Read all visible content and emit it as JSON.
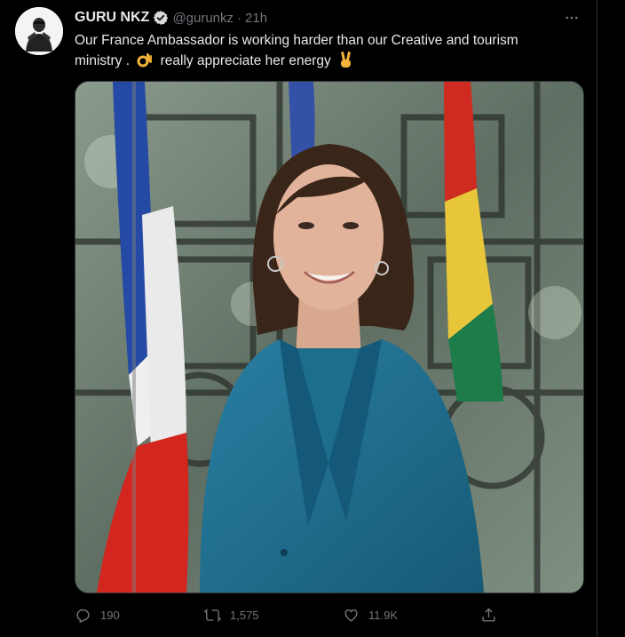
{
  "tweet": {
    "author_name": "GURU NKZ",
    "handle": "@gurunkz",
    "separator": "·",
    "time": "21h",
    "text_line1": "Our France Ambassador is working harder than our Creative and tourism",
    "text_line2a": "ministry .",
    "text_line2b": "really appreciate her energy",
    "emoji_1": "ok-hand-emoji",
    "emoji_2": "victory-hand-emoji"
  },
  "actions": {
    "replies": "190",
    "retweets": "1,575",
    "likes": "11.9K"
  },
  "icons": {
    "verified": "verified-badge-icon",
    "more": "more-icon",
    "reply": "reply-icon",
    "retweet": "retweet-icon",
    "like": "like-icon",
    "share": "share-icon"
  },
  "colors": {
    "background": "#000000",
    "text": "#e7e9ea",
    "muted": "#71767b",
    "border": "#2f3336",
    "blazer": "#1f6b8a"
  }
}
